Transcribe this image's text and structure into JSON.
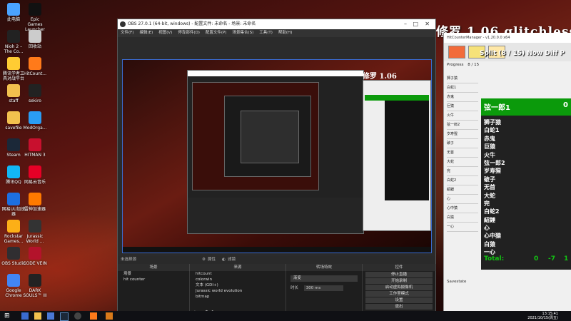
{
  "desktop": {
    "icons": [
      {
        "label": "此电脑",
        "icon": "computer-icon",
        "color": "#4aa3ff"
      },
      {
        "label": "Epic Games Launcher",
        "icon": "epic-icon",
        "color": "#111111"
      },
      {
        "label": "Nioh 2 – The Co...",
        "icon": "nioh-icon",
        "color": "#222222"
      },
      {
        "label": "回收站",
        "icon": "recycle-bin-icon",
        "color": "#cccccc"
      },
      {
        "label": "腾讯学者工具对战平台",
        "icon": "platform-icon",
        "color": "#ffcc33"
      },
      {
        "label": "HitCount...",
        "icon": "hitcounter-icon",
        "color": "#ff7a1a"
      },
      {
        "label": "staff",
        "icon": "folder-icon",
        "color": "#f2c14e"
      },
      {
        "label": "sekiro",
        "icon": "sekiro-icon",
        "color": "#222222"
      },
      {
        "label": "savefile",
        "icon": "folder-icon",
        "color": "#f2c14e"
      },
      {
        "label": "ModOrga...",
        "icon": "modorganizer-icon",
        "color": "#2a9df4"
      },
      {
        "label": "Steam",
        "icon": "steam-icon",
        "color": "#1b2838"
      },
      {
        "label": "HITMAN 3",
        "icon": "hitman-icon",
        "color": "#c8102e"
      },
      {
        "label": "腾讯QQ",
        "icon": "qq-icon",
        "color": "#12b7f5"
      },
      {
        "label": "网易云音乐",
        "icon": "netease-music-icon",
        "color": "#e60026"
      },
      {
        "label": "网易UU加速器",
        "icon": "uu-icon",
        "color": "#1d6fe0"
      },
      {
        "label": "雷神加速器",
        "icon": "leishen-icon",
        "color": "#ff7a00"
      },
      {
        "label": "Rockstar Games...",
        "icon": "rockstar-icon",
        "color": "#fcaf17"
      },
      {
        "label": "Jurassic World ...",
        "icon": "jurassic-icon",
        "color": "#333333"
      },
      {
        "label": "OBS Studio",
        "icon": "obs-icon",
        "color": "#302e31"
      },
      {
        "label": "CODE VEIN",
        "icon": "codevein-icon",
        "color": "#b3132b"
      },
      {
        "label": "Google Chrome",
        "icon": "chrome-icon",
        "color": "#4285f4"
      },
      {
        "label": "DARK SOULS™ III",
        "icon": "darksouls-icon",
        "color": "#222222"
      }
    ]
  },
  "obs": {
    "title": "OBS 27.0.1 (64-bit, windows) - 配置文件: 未命名 - 场景: 未命名",
    "menu": [
      "文件(F)",
      "编辑(E)",
      "视图(V)",
      "停靠部件(D)",
      "配置文件(P)",
      "场景集合(S)",
      "工具(T)",
      "帮助(H)"
    ],
    "preview_overlay": "修罗 1.06 glitchless",
    "source_bar": {
      "label": "未选择源",
      "props": "属性",
      "filters": "滤镜"
    },
    "docks": {
      "scenes": {
        "title": "场景",
        "items": [
          "场景",
          "hit counter"
        ]
      },
      "sources": {
        "title": "来源",
        "items": [
          "hitcount",
          "colorwin",
          "文本 (GDI+)",
          "Jurassic world evolution",
          "bitmap"
        ]
      },
      "transitions": {
        "title": "转场特效",
        "type": "渐变",
        "duration_label": "时长",
        "duration": "300 ms"
      },
      "controls": {
        "title": "控件",
        "buttons": [
          "停止直播",
          "开始录制",
          "启动虚拟摄像机",
          "工作室模式",
          "设置",
          "退出"
        ]
      }
    }
  },
  "counter": {
    "title_overlay": "修罗 1.06 glitchless",
    "window_title": "HitCounterManager - v1.20.0.0 x64",
    "header_text": "Split (8 / 15) Now Diff P",
    "progress_label": "Progress",
    "progress": "8 / 15",
    "current_split": "弦一郎1",
    "splits": [
      "狮子猿",
      "白蛇1",
      "赤鬼",
      "巨猿",
      "火牛",
      "弦一郎2",
      "岁寿猩",
      "破子",
      "无首",
      "大蛇",
      "完",
      "白蛇2",
      "紹錘",
      "心",
      "心中猿",
      "白猿",
      "一心"
    ],
    "total_label": "Total:",
    "total_values": [
      "0",
      "-7",
      "1"
    ],
    "footer": "Savestate",
    "colors": {
      "green": "#0b9a0b",
      "panel": "#0a0a0a"
    }
  },
  "taskbar": {
    "time": "13:15:41",
    "date": "2021/10/15(周五)"
  }
}
